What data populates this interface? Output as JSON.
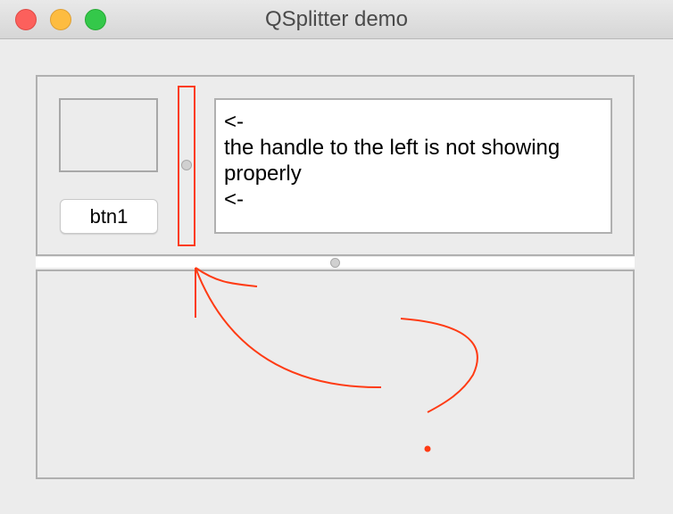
{
  "window": {
    "title": "QSplitter demo"
  },
  "top_panel": {
    "button_label": "btn1",
    "text_lines": [
      "<-",
      "the handle to the left is not showing",
      "properly",
      "<-"
    ]
  },
  "colors": {
    "annotation": "#ff3b14",
    "close": "#fc605c",
    "minimize": "#fdbc40",
    "maximize": "#34c84a"
  }
}
